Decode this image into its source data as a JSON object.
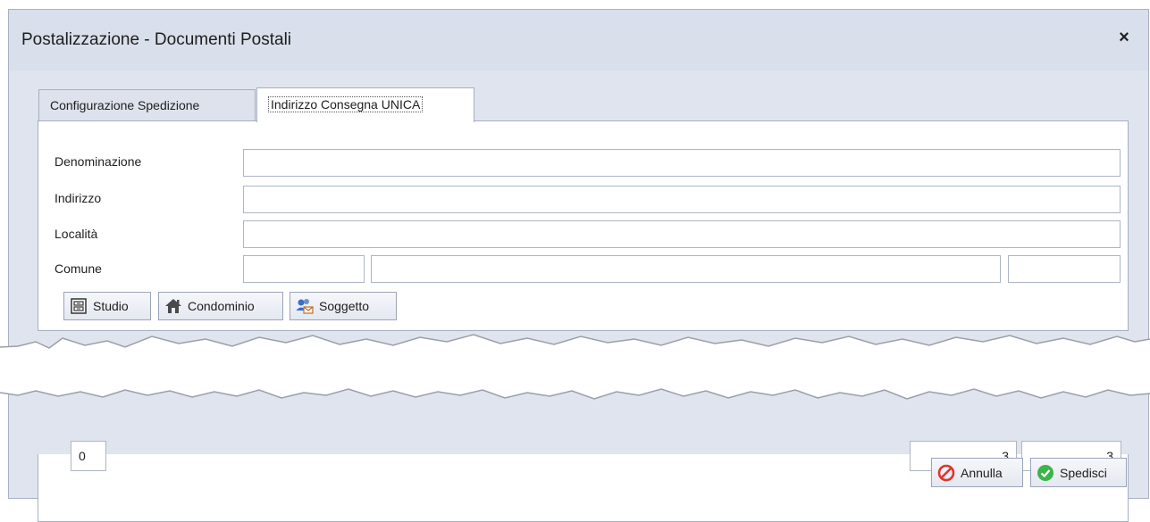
{
  "window": {
    "title": "Postalizzazione - Documenti Postali",
    "close_label": "×"
  },
  "tabs": [
    {
      "label": "Configurazione Spedizione",
      "active": false
    },
    {
      "label": "Indirizzo Consegna UNICA",
      "active": true
    }
  ],
  "form": {
    "denominazione_label": "Denominazione",
    "denominazione_value": "",
    "indirizzo_label": "Indirizzo",
    "indirizzo_value": "",
    "localita_label": "Località",
    "localita_value": "",
    "comune_label": "Comune",
    "comune_cap_value": "",
    "comune_nome_value": "",
    "comune_prov_value": ""
  },
  "buttons": {
    "studio_label": "Studio",
    "condominio_label": "Condominio",
    "soggetto_label": "Soggetto",
    "annulla_label": "Annulla",
    "spedisci_label": "Spedisci"
  },
  "counters": {
    "left_value": "0",
    "mid_value": "3",
    "right_value": "3"
  },
  "colors": {
    "titlebar_bg": "#d9dfeb",
    "content_bg": "#dfe4ee",
    "annulla_icon": "#e0342a",
    "spedisci_icon": "#3db34a"
  }
}
